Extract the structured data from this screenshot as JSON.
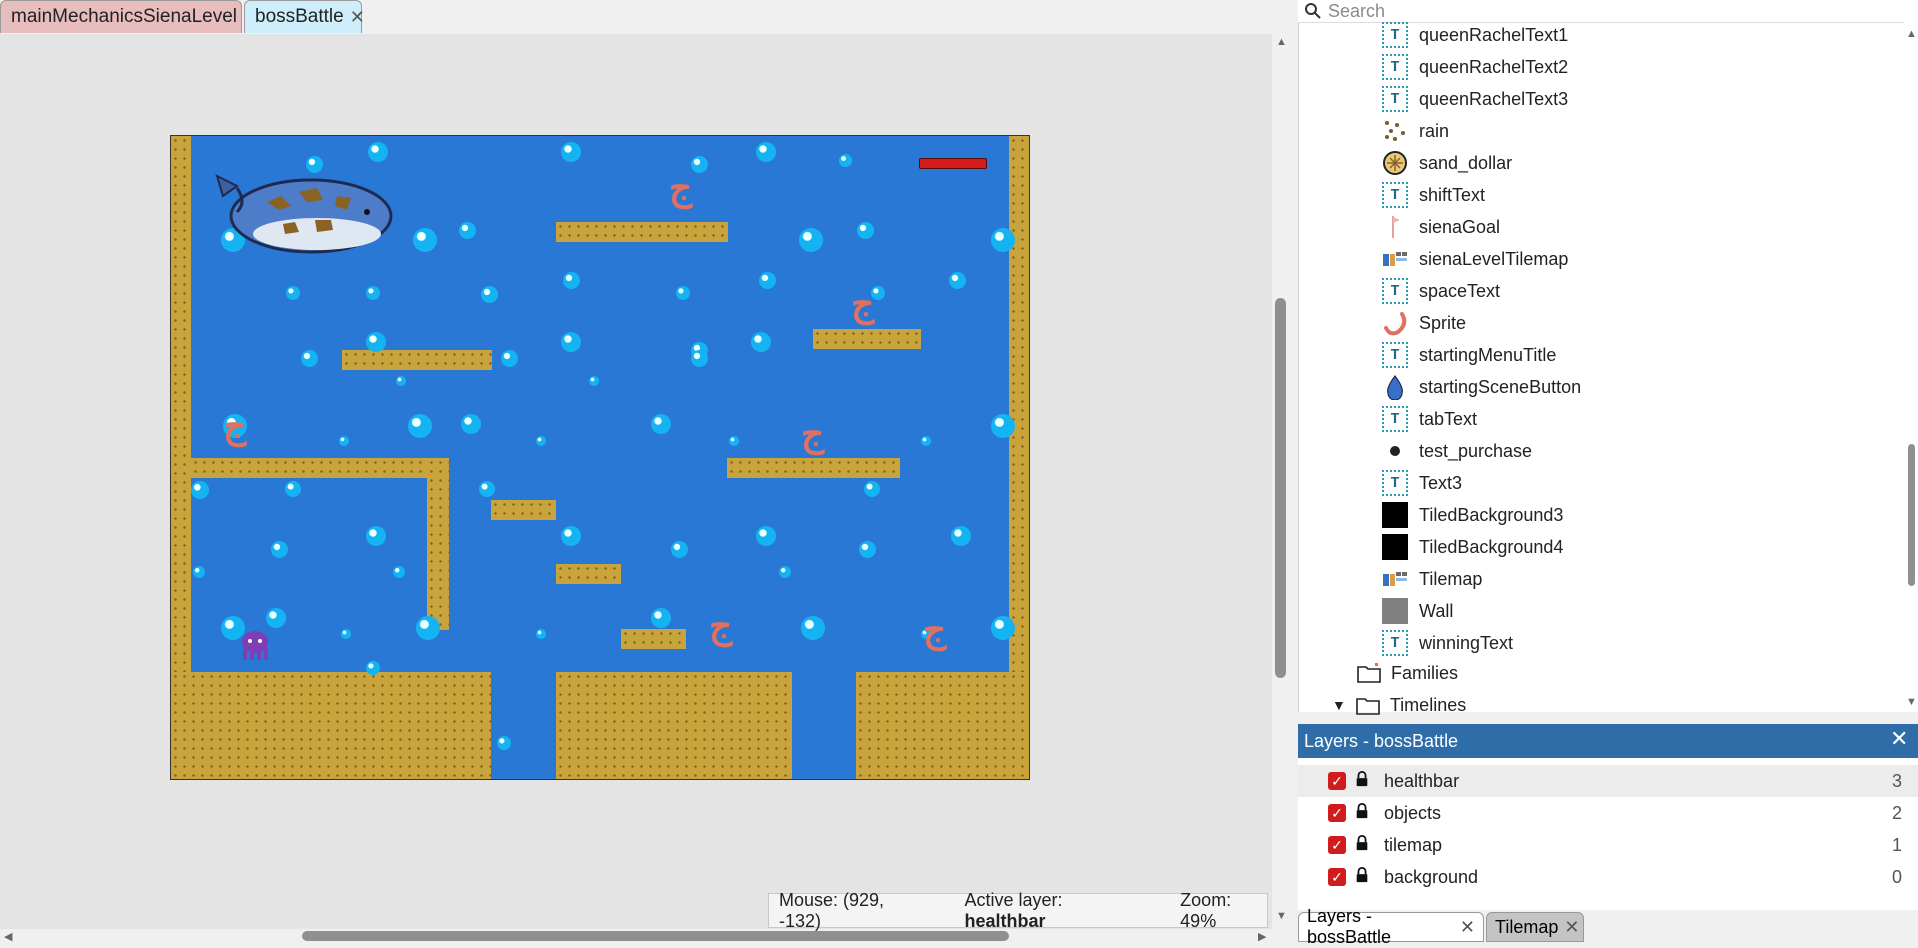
{
  "tabs": [
    {
      "label": "mainMechanicsSienaLevel",
      "close": "✕"
    },
    {
      "label": "bossBattle",
      "close": "✕"
    }
  ],
  "status": {
    "mouse": "Mouse: (929, -132)",
    "active_layer_label": "Active layer:",
    "active_layer_value": "healthbar",
    "zoom": "Zoom: 49%"
  },
  "objects_panel": {
    "search_placeholder": "Search",
    "items": [
      {
        "label": "queenRachelText1",
        "icon": "text-icon"
      },
      {
        "label": "queenRachelText2",
        "icon": "text-icon"
      },
      {
        "label": "queenRachelText3",
        "icon": "text-icon"
      },
      {
        "label": "rain",
        "icon": "particles-icon"
      },
      {
        "label": "sand_dollar",
        "icon": "sand-dollar-icon"
      },
      {
        "label": "shiftText",
        "icon": "text-icon"
      },
      {
        "label": "sienaGoal",
        "icon": "flag-icon"
      },
      {
        "label": "sienaLevelTilemap",
        "icon": "tilemap-icon"
      },
      {
        "label": "spaceText",
        "icon": "text-icon"
      },
      {
        "label": "Sprite",
        "icon": "shrimp-icon"
      },
      {
        "label": "startingMenuTitle",
        "icon": "text-icon"
      },
      {
        "label": "startingSceneButton",
        "icon": "drop-icon"
      },
      {
        "label": "tabText",
        "icon": "text-icon"
      },
      {
        "label": "test_purchase",
        "icon": "dot-icon"
      },
      {
        "label": "Text3",
        "icon": "text-icon"
      },
      {
        "label": "TiledBackground3",
        "icon": "black-square-icon"
      },
      {
        "label": "TiledBackground4",
        "icon": "black-square-icon"
      },
      {
        "label": "Tilemap",
        "icon": "tilemap-icon"
      },
      {
        "label": "Wall",
        "icon": "gray-square-icon"
      },
      {
        "label": "winningText",
        "icon": "text-icon"
      }
    ],
    "folders": [
      {
        "label": "Families"
      },
      {
        "label": "Timelines"
      }
    ],
    "text_icon_glyph": "T"
  },
  "layers_panel": {
    "title": "Layers - bossBattle",
    "close": "✕",
    "layers": [
      {
        "name": "healthbar",
        "index": "3",
        "checked": true
      },
      {
        "name": "objects",
        "index": "2",
        "checked": true
      },
      {
        "name": "tilemap",
        "index": "1",
        "checked": true
      },
      {
        "name": "background",
        "index": "0",
        "checked": true
      }
    ],
    "check_glyph": "✓"
  },
  "bottom_tabs": [
    {
      "label": "Layers - bossBattle",
      "close": "✕"
    },
    {
      "label": "Tilemap",
      "close": "✕"
    }
  ],
  "colors": {
    "water": "#2a78d5",
    "sand": "#c9a43c",
    "layers_header": "#2e6da8",
    "tab_main": "#e7bdbd",
    "tab_active": "#cdeefa",
    "checkbox": "#d01c1c"
  }
}
